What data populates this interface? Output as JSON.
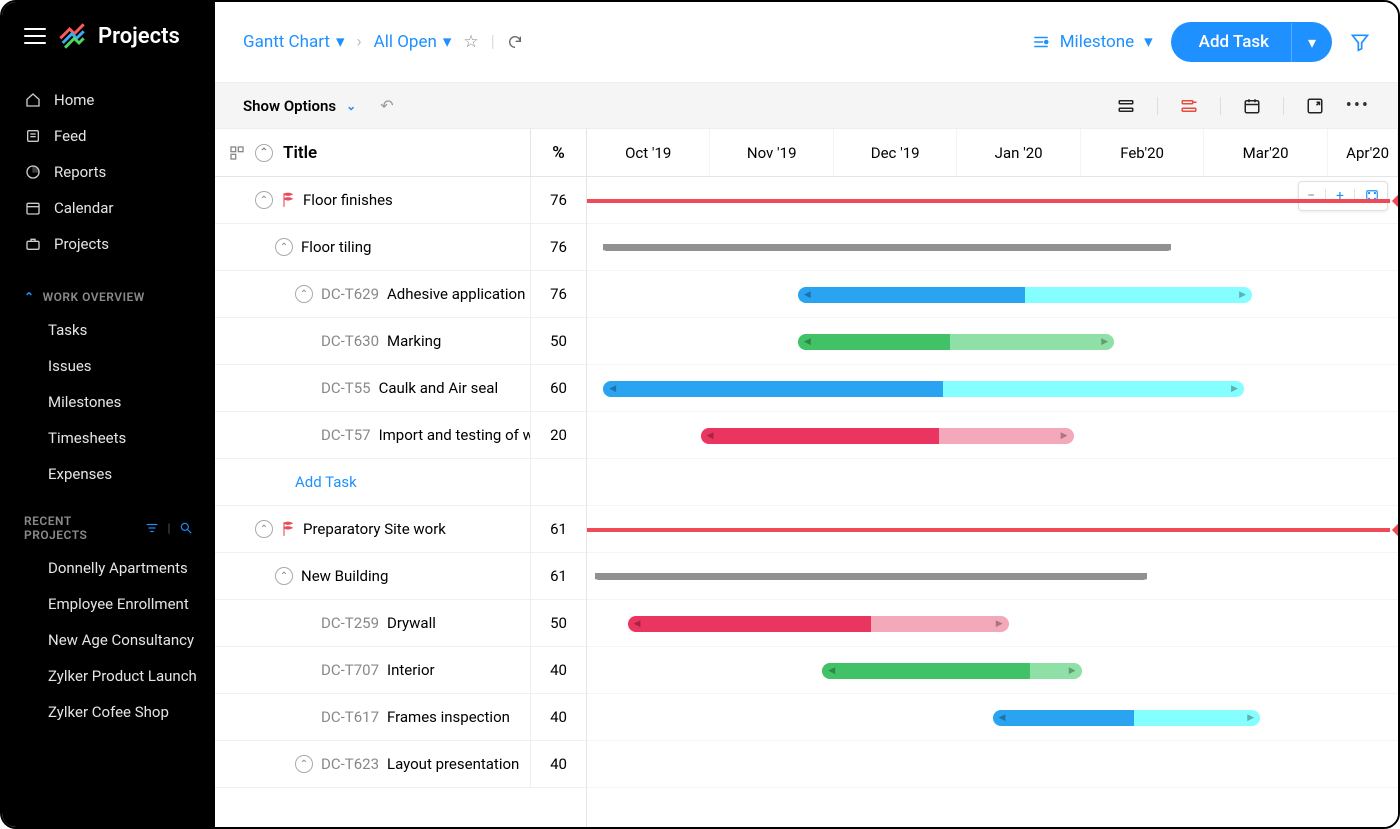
{
  "brand": {
    "name": "Projects"
  },
  "nav": {
    "items": [
      {
        "label": "Home",
        "icon": "home"
      },
      {
        "label": "Feed",
        "icon": "feed"
      },
      {
        "label": "Reports",
        "icon": "reports"
      },
      {
        "label": "Calendar",
        "icon": "calendar"
      },
      {
        "label": "Projects",
        "icon": "briefcase"
      }
    ]
  },
  "work_overview": {
    "label": "WORK OVERVIEW",
    "items": [
      "Tasks",
      "Issues",
      "Milestones",
      "Timesheets",
      "Expenses"
    ]
  },
  "recent_projects": {
    "label": "RECENT PROJECTS",
    "items": [
      "Donnelly Apartments",
      "Employee Enrollment",
      "New Age Consultancy",
      "Zylker Product Launch",
      "Zylker Cofee Shop"
    ]
  },
  "breadcrumb": {
    "view": "Gantt Chart",
    "filter": "All Open"
  },
  "topbar": {
    "milestone": "Milestone",
    "add_task": "Add Task"
  },
  "subbar": {
    "show_options": "Show Options"
  },
  "columns": {
    "title": "Title",
    "percent": "%"
  },
  "timeline": {
    "months": [
      "Oct '19",
      "Nov '19",
      "Dec '19",
      "Jan '20",
      "Feb'20",
      "Mar'20",
      "Apr'20"
    ]
  },
  "rows": [
    {
      "type": "milestone",
      "title": "Floor finishes",
      "percent": 76,
      "indent": 0,
      "bar": {
        "start": 0,
        "end": 99,
        "color": "#ef4a55",
        "style": "milestone"
      }
    },
    {
      "type": "group",
      "title": "Floor tiling",
      "percent": 76,
      "indent": 1,
      "bar": {
        "start": 2,
        "end": 72,
        "style": "group"
      }
    },
    {
      "type": "task",
      "id": "DC-T629",
      "title": "Adhesive application",
      "percent": 76,
      "indent": 2,
      "bar": {
        "start": 26,
        "end": 82,
        "color": "#2aa4f0",
        "prog": 50
      }
    },
    {
      "type": "task",
      "id": "DC-T630",
      "title": "Marking",
      "percent": 50,
      "indent": 2,
      "bar": {
        "start": 26,
        "end": 65,
        "color": "#41c266",
        "prog": 48,
        "light": "#8fe0a6"
      }
    },
    {
      "type": "task",
      "id": "DC-T55",
      "title": "Caulk and Air seal",
      "percent": 60,
      "indent": 2,
      "bar": {
        "start": 2,
        "end": 81,
        "color": "#2aa4f0",
        "prog": 53
      }
    },
    {
      "type": "task",
      "id": "DC-T57",
      "title": "Import and testing of woo..",
      "percent": 20,
      "indent": 2,
      "bar": {
        "start": 14,
        "end": 60,
        "color": "#ea3561",
        "prog": 64,
        "light": "#f3a9b9"
      }
    },
    {
      "type": "addtask",
      "title": "Add Task",
      "indent": 2
    },
    {
      "type": "milestone",
      "title": "Preparatory Site work",
      "percent": 61,
      "indent": 0,
      "bar": {
        "start": 0,
        "end": 99,
        "color": "#ef4a55",
        "style": "milestone"
      }
    },
    {
      "type": "group",
      "title": "New Building",
      "percent": 61,
      "indent": 1,
      "bar": {
        "start": 1,
        "end": 69,
        "style": "group"
      }
    },
    {
      "type": "task",
      "id": "DC-T259",
      "title": "Drywall",
      "percent": 50,
      "indent": 2,
      "bar": {
        "start": 5,
        "end": 52,
        "color": "#ea3561",
        "prog": 64,
        "light": "#f3a9b9"
      }
    },
    {
      "type": "task",
      "id": "DC-T707",
      "title": "Interior",
      "percent": 40,
      "indent": 2,
      "bar": {
        "start": 29,
        "end": 61,
        "color": "#41c266",
        "prog": 80,
        "light": "#8fe0a6"
      }
    },
    {
      "type": "task",
      "id": "DC-T617",
      "title": "Frames inspection",
      "percent": 40,
      "indent": 2,
      "bar": {
        "start": 50,
        "end": 83,
        "color": "#2aa4f0",
        "prog": 53
      }
    },
    {
      "type": "task",
      "id": "DC-T623",
      "title": "Layout presentation",
      "percent": 40,
      "indent": 2
    }
  ]
}
